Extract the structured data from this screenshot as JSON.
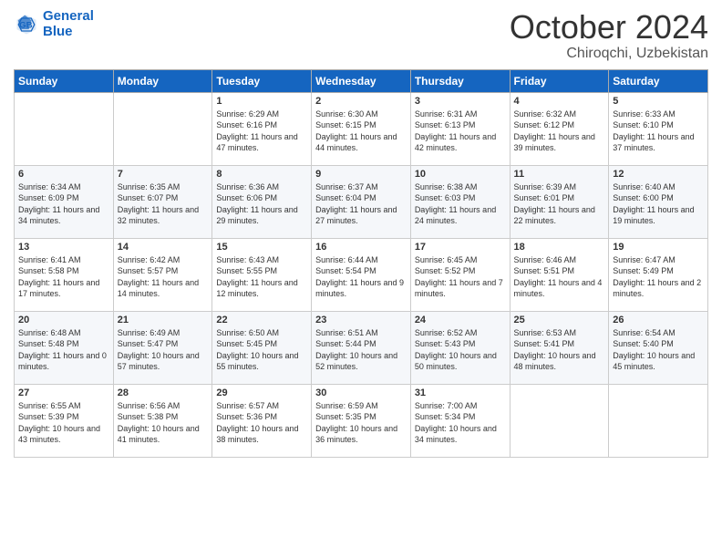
{
  "header": {
    "logo_line1": "General",
    "logo_line2": "Blue",
    "month": "October 2024",
    "location": "Chiroqchi, Uzbekistan"
  },
  "days_of_week": [
    "Sunday",
    "Monday",
    "Tuesday",
    "Wednesday",
    "Thursday",
    "Friday",
    "Saturday"
  ],
  "weeks": [
    [
      {
        "day": "",
        "sunrise": "",
        "sunset": "",
        "daylight": ""
      },
      {
        "day": "",
        "sunrise": "",
        "sunset": "",
        "daylight": ""
      },
      {
        "day": "1",
        "sunrise": "Sunrise: 6:29 AM",
        "sunset": "Sunset: 6:16 PM",
        "daylight": "Daylight: 11 hours and 47 minutes."
      },
      {
        "day": "2",
        "sunrise": "Sunrise: 6:30 AM",
        "sunset": "Sunset: 6:15 PM",
        "daylight": "Daylight: 11 hours and 44 minutes."
      },
      {
        "day": "3",
        "sunrise": "Sunrise: 6:31 AM",
        "sunset": "Sunset: 6:13 PM",
        "daylight": "Daylight: 11 hours and 42 minutes."
      },
      {
        "day": "4",
        "sunrise": "Sunrise: 6:32 AM",
        "sunset": "Sunset: 6:12 PM",
        "daylight": "Daylight: 11 hours and 39 minutes."
      },
      {
        "day": "5",
        "sunrise": "Sunrise: 6:33 AM",
        "sunset": "Sunset: 6:10 PM",
        "daylight": "Daylight: 11 hours and 37 minutes."
      }
    ],
    [
      {
        "day": "6",
        "sunrise": "Sunrise: 6:34 AM",
        "sunset": "Sunset: 6:09 PM",
        "daylight": "Daylight: 11 hours and 34 minutes."
      },
      {
        "day": "7",
        "sunrise": "Sunrise: 6:35 AM",
        "sunset": "Sunset: 6:07 PM",
        "daylight": "Daylight: 11 hours and 32 minutes."
      },
      {
        "day": "8",
        "sunrise": "Sunrise: 6:36 AM",
        "sunset": "Sunset: 6:06 PM",
        "daylight": "Daylight: 11 hours and 29 minutes."
      },
      {
        "day": "9",
        "sunrise": "Sunrise: 6:37 AM",
        "sunset": "Sunset: 6:04 PM",
        "daylight": "Daylight: 11 hours and 27 minutes."
      },
      {
        "day": "10",
        "sunrise": "Sunrise: 6:38 AM",
        "sunset": "Sunset: 6:03 PM",
        "daylight": "Daylight: 11 hours and 24 minutes."
      },
      {
        "day": "11",
        "sunrise": "Sunrise: 6:39 AM",
        "sunset": "Sunset: 6:01 PM",
        "daylight": "Daylight: 11 hours and 22 minutes."
      },
      {
        "day": "12",
        "sunrise": "Sunrise: 6:40 AM",
        "sunset": "Sunset: 6:00 PM",
        "daylight": "Daylight: 11 hours and 19 minutes."
      }
    ],
    [
      {
        "day": "13",
        "sunrise": "Sunrise: 6:41 AM",
        "sunset": "Sunset: 5:58 PM",
        "daylight": "Daylight: 11 hours and 17 minutes."
      },
      {
        "day": "14",
        "sunrise": "Sunrise: 6:42 AM",
        "sunset": "Sunset: 5:57 PM",
        "daylight": "Daylight: 11 hours and 14 minutes."
      },
      {
        "day": "15",
        "sunrise": "Sunrise: 6:43 AM",
        "sunset": "Sunset: 5:55 PM",
        "daylight": "Daylight: 11 hours and 12 minutes."
      },
      {
        "day": "16",
        "sunrise": "Sunrise: 6:44 AM",
        "sunset": "Sunset: 5:54 PM",
        "daylight": "Daylight: 11 hours and 9 minutes."
      },
      {
        "day": "17",
        "sunrise": "Sunrise: 6:45 AM",
        "sunset": "Sunset: 5:52 PM",
        "daylight": "Daylight: 11 hours and 7 minutes."
      },
      {
        "day": "18",
        "sunrise": "Sunrise: 6:46 AM",
        "sunset": "Sunset: 5:51 PM",
        "daylight": "Daylight: 11 hours and 4 minutes."
      },
      {
        "day": "19",
        "sunrise": "Sunrise: 6:47 AM",
        "sunset": "Sunset: 5:49 PM",
        "daylight": "Daylight: 11 hours and 2 minutes."
      }
    ],
    [
      {
        "day": "20",
        "sunrise": "Sunrise: 6:48 AM",
        "sunset": "Sunset: 5:48 PM",
        "daylight": "Daylight: 11 hours and 0 minutes."
      },
      {
        "day": "21",
        "sunrise": "Sunrise: 6:49 AM",
        "sunset": "Sunset: 5:47 PM",
        "daylight": "Daylight: 10 hours and 57 minutes."
      },
      {
        "day": "22",
        "sunrise": "Sunrise: 6:50 AM",
        "sunset": "Sunset: 5:45 PM",
        "daylight": "Daylight: 10 hours and 55 minutes."
      },
      {
        "day": "23",
        "sunrise": "Sunrise: 6:51 AM",
        "sunset": "Sunset: 5:44 PM",
        "daylight": "Daylight: 10 hours and 52 minutes."
      },
      {
        "day": "24",
        "sunrise": "Sunrise: 6:52 AM",
        "sunset": "Sunset: 5:43 PM",
        "daylight": "Daylight: 10 hours and 50 minutes."
      },
      {
        "day": "25",
        "sunrise": "Sunrise: 6:53 AM",
        "sunset": "Sunset: 5:41 PM",
        "daylight": "Daylight: 10 hours and 48 minutes."
      },
      {
        "day": "26",
        "sunrise": "Sunrise: 6:54 AM",
        "sunset": "Sunset: 5:40 PM",
        "daylight": "Daylight: 10 hours and 45 minutes."
      }
    ],
    [
      {
        "day": "27",
        "sunrise": "Sunrise: 6:55 AM",
        "sunset": "Sunset: 5:39 PM",
        "daylight": "Daylight: 10 hours and 43 minutes."
      },
      {
        "day": "28",
        "sunrise": "Sunrise: 6:56 AM",
        "sunset": "Sunset: 5:38 PM",
        "daylight": "Daylight: 10 hours and 41 minutes."
      },
      {
        "day": "29",
        "sunrise": "Sunrise: 6:57 AM",
        "sunset": "Sunset: 5:36 PM",
        "daylight": "Daylight: 10 hours and 38 minutes."
      },
      {
        "day": "30",
        "sunrise": "Sunrise: 6:59 AM",
        "sunset": "Sunset: 5:35 PM",
        "daylight": "Daylight: 10 hours and 36 minutes."
      },
      {
        "day": "31",
        "sunrise": "Sunrise: 7:00 AM",
        "sunset": "Sunset: 5:34 PM",
        "daylight": "Daylight: 10 hours and 34 minutes."
      },
      {
        "day": "",
        "sunrise": "",
        "sunset": "",
        "daylight": ""
      },
      {
        "day": "",
        "sunrise": "",
        "sunset": "",
        "daylight": ""
      }
    ]
  ]
}
